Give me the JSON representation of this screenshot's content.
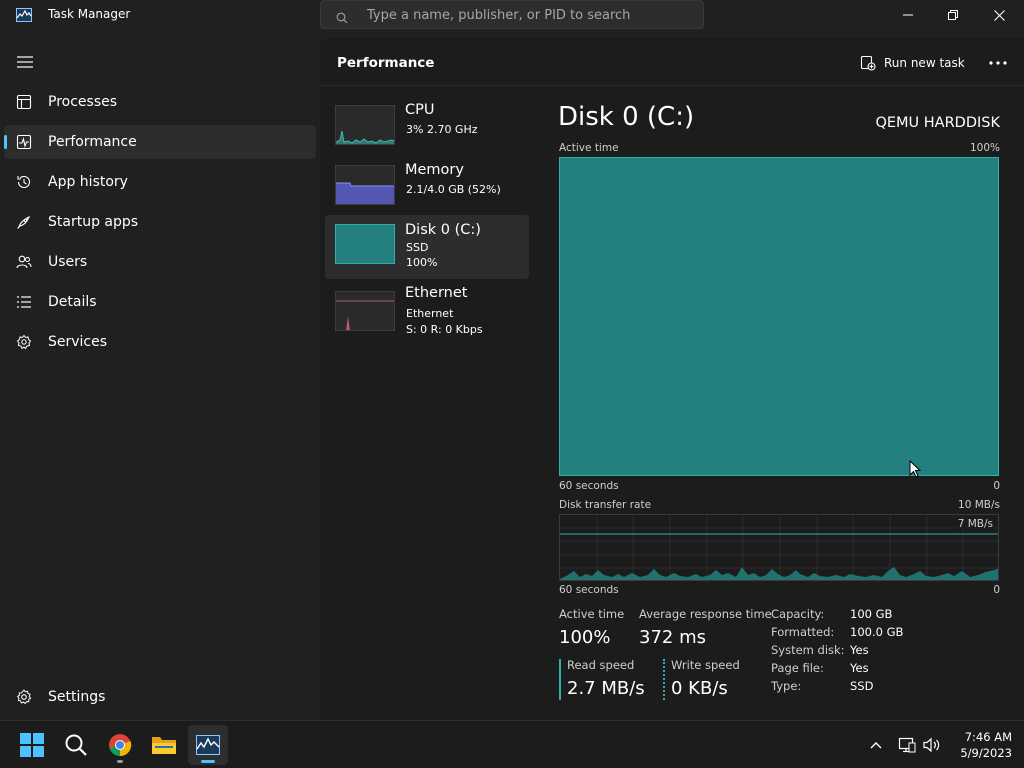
{
  "window": {
    "title": "Task Manager",
    "search_placeholder": "Type a name, publisher, or PID to search"
  },
  "sidebar": {
    "items": [
      {
        "label": "Processes",
        "icon": "processes-icon"
      },
      {
        "label": "Performance",
        "icon": "performance-icon",
        "active": true
      },
      {
        "label": "App history",
        "icon": "history-icon"
      },
      {
        "label": "Startup apps",
        "icon": "startup-icon"
      },
      {
        "label": "Users",
        "icon": "users-icon"
      },
      {
        "label": "Details",
        "icon": "details-icon"
      },
      {
        "label": "Services",
        "icon": "services-icon"
      }
    ],
    "settings_label": "Settings"
  },
  "header": {
    "title": "Performance",
    "run_task_label": "Run new task"
  },
  "devices": [
    {
      "name": "CPU",
      "line1": "3%  2.70 GHz"
    },
    {
      "name": "Memory",
      "line1": "2.1/4.0 GB (52%)"
    },
    {
      "name": "Disk 0 (C:)",
      "line1": "SSD",
      "line2": "100%",
      "selected": true
    },
    {
      "name": "Ethernet",
      "line1": "Ethernet",
      "line2": "S: 0  R: 0 Kbps"
    }
  ],
  "detail": {
    "title": "Disk 0 (C:)",
    "model": "QEMU HARDDISK",
    "active_time_graph": {
      "label": "Active time",
      "max": "100%",
      "span": "60 seconds",
      "min": "0",
      "level_percent": 100
    },
    "transfer_graph": {
      "label": "Disk transfer rate",
      "max": "10 MB/s",
      "marker": "7 MB/s",
      "span": "60 seconds",
      "min": "0"
    },
    "stats": {
      "active_time_label": "Active time",
      "active_time_value": "100%",
      "response_label": "Average response time",
      "response_value": "372 ms",
      "read_label": "Read speed",
      "read_value": "2.7 MB/s",
      "write_label": "Write speed",
      "write_value": "0 KB/s"
    },
    "properties": [
      {
        "label": "Capacity:",
        "value": "100 GB"
      },
      {
        "label": "Formatted:",
        "value": "100.0 GB"
      },
      {
        "label": "System disk:",
        "value": "Yes"
      },
      {
        "label": "Page file:",
        "value": "Yes"
      },
      {
        "label": "Type:",
        "value": "SSD"
      }
    ]
  },
  "taskbar": {
    "apps": [
      "start-icon",
      "search-icon",
      "chrome-icon",
      "file-explorer-icon",
      "task-manager-icon"
    ],
    "time": "7:46 AM",
    "date": "5/9/2023"
  },
  "colors": {
    "accent": "#4cc2ff",
    "disk": "#23807e",
    "disk_border": "#2fb1ab",
    "cpu": "#3fb6b0",
    "memory": "#5a5fc9",
    "ethernet": "#d96b8b",
    "background": "#202020"
  }
}
